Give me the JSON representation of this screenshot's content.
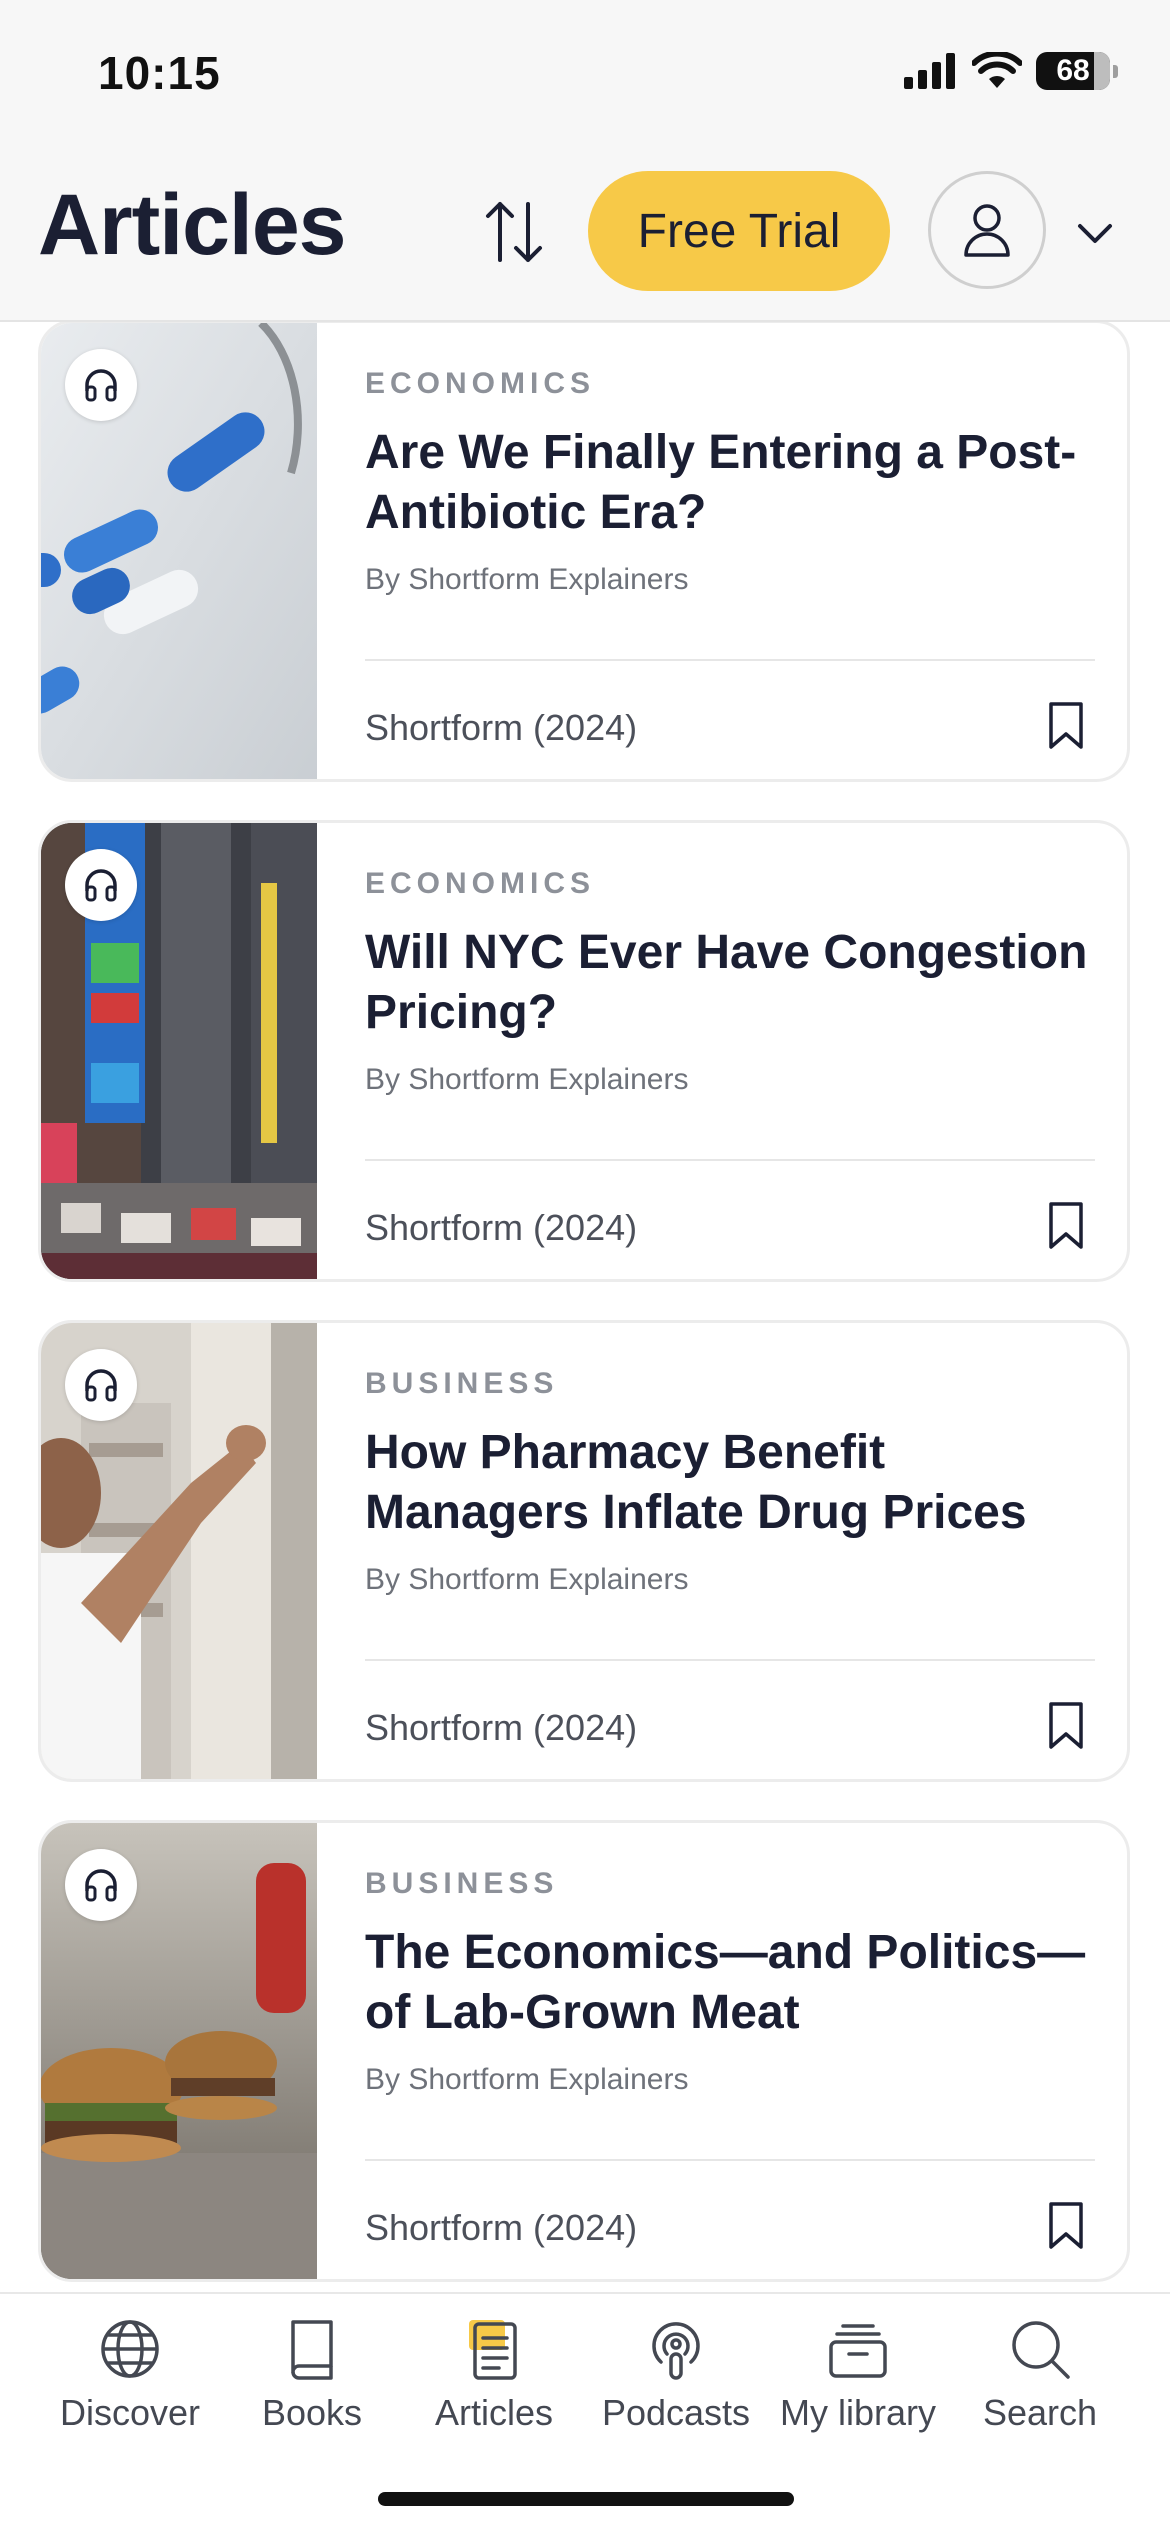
{
  "status_bar": {
    "time": "10:15",
    "battery": "68"
  },
  "header": {
    "title": "Articles",
    "trial_label": "Free Trial"
  },
  "articles": [
    {
      "category": "ECONOMICS",
      "title": "Are We Finally Entering a Post-Antibiotic Era?",
      "author": "By Shortform Explainers",
      "source": "Shortform (2024)"
    },
    {
      "category": "ECONOMICS",
      "title": "Will NYC Ever Have Congestion Pricing?",
      "author": "By Shortform Explainers",
      "source": "Shortform (2024)"
    },
    {
      "category": "BUSINESS",
      "title": "How Pharmacy Benefit Managers Inflate Drug Prices",
      "author": "By Shortform Explainers",
      "source": "Shortform (2024)"
    },
    {
      "category": "BUSINESS",
      "title": "The Economics—and Politics—of Lab-Grown Meat",
      "author": "By Shortform Explainers",
      "source": "Shortform (2024)"
    }
  ],
  "tabs": [
    {
      "label": "Discover",
      "icon": "globe-icon"
    },
    {
      "label": "Books",
      "icon": "book-icon"
    },
    {
      "label": "Articles",
      "icon": "article-icon"
    },
    {
      "label": "Podcasts",
      "icon": "podcast-icon"
    },
    {
      "label": "My library",
      "icon": "library-icon"
    },
    {
      "label": "Search",
      "icon": "search-icon"
    }
  ],
  "colors": {
    "accent": "#f7c948",
    "title": "#1b1f33",
    "category": "#8d9199"
  }
}
